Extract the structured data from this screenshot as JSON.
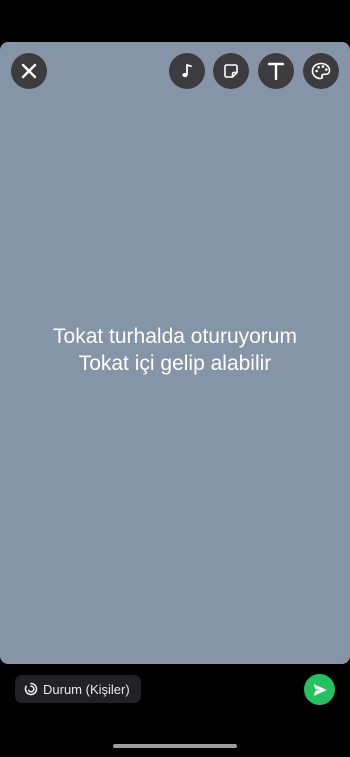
{
  "toolbar": {
    "close_icon": "close-icon",
    "music_icon": "music-note-icon",
    "sticker_icon": "sticker-icon",
    "text_icon": "text-icon",
    "palette_icon": "palette-icon"
  },
  "status": {
    "line1": "Tokat turhalda oturuyorum",
    "line2": "Tokat içi gelip alabilir",
    "background_color": "#8595a7"
  },
  "footer": {
    "audience_label": "Durum (Kişiler)",
    "audience_icon": "status-ring-icon",
    "send_icon": "send-icon",
    "send_color": "#25c05f"
  }
}
